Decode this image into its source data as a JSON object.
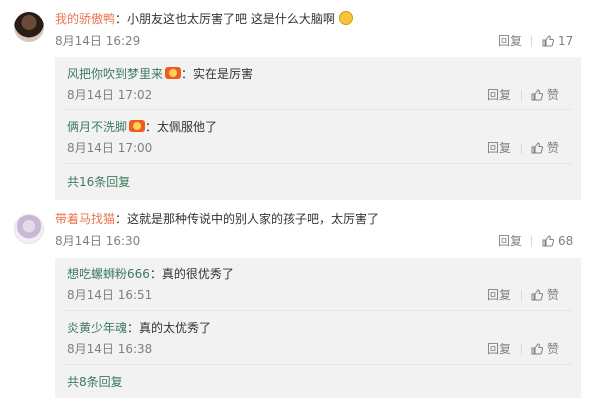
{
  "comments": [
    {
      "username": "我的骄傲鸭",
      "text": "：小朋友这也太厉害了吧  这是什么大脑啊",
      "emoji": "face-emoji",
      "time": "8月14日 16:29",
      "reply_label": "回复",
      "like_count": "17",
      "replies": [
        {
          "username": "风把你吹到梦里来",
          "text": "：实在是厉害",
          "time": "8月14日 17:02",
          "reply_label": "回复",
          "like_label": "赞"
        },
        {
          "username": "俩月不洗脚",
          "text": "：太佩服他了",
          "time": "8月14日 17:00",
          "reply_label": "回复",
          "like_label": "赞"
        }
      ],
      "more_replies": "共16条回复"
    },
    {
      "username": "带着马找猫",
      "text": "：这就是那种传说中的别人家的孩子吧，太厉害了",
      "time": "8月14日 16:30",
      "reply_label": "回复",
      "like_count": "68",
      "replies": [
        {
          "username": "想吃螺蛳粉666",
          "text": "：真的很优秀了",
          "time": "8月14日 16:51",
          "reply_label": "回复",
          "like_label": "赞"
        },
        {
          "username": "炎黄少年魂",
          "text": "：真的太优秀了",
          "time": "8月14日 16:38",
          "reply_label": "回复",
          "like_label": "赞"
        }
      ],
      "more_replies": "共8条回复"
    }
  ],
  "colors": {
    "username": "#eb7350",
    "link_green": "#3c7a5f",
    "reply_bg": "#f2f2f2",
    "meta": "#808080"
  }
}
